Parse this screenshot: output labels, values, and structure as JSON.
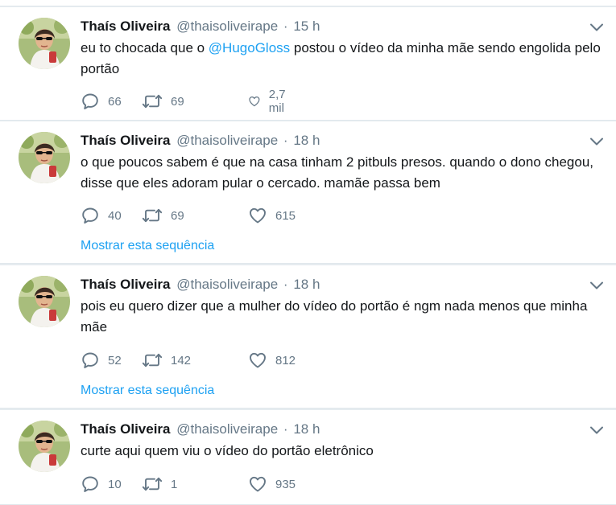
{
  "tweets": [
    {
      "name": "Thaís Oliveira",
      "handle": "@thaisoliveirape",
      "separator": "·",
      "time": "15 h",
      "text_before": "eu to chocada que o ",
      "mention": "@HugoGloss",
      "text_after": " postou o vídeo da minha mãe sendo engolida pelo portão",
      "replies": "66",
      "retweets": "69",
      "likes": "2,7 mil"
    },
    {
      "name": "Thaís Oliveira",
      "handle": "@thaisoliveirape",
      "separator": "·",
      "time": "18 h",
      "text": "o que poucos sabem é que na casa tinham 2 pitbuls presos. quando o dono chegou, disse que eles adoram pular o cercado. mamãe passa bem",
      "replies": "40",
      "retweets": "69",
      "likes": "615",
      "show_thread": "Mostrar esta sequência"
    },
    {
      "name": "Thaís Oliveira",
      "handle": "@thaisoliveirape",
      "separator": "·",
      "time": "18 h",
      "text": "pois eu quero dizer que a mulher do vídeo do portão é ngm nada menos que minha mãe",
      "replies": "52",
      "retweets": "142",
      "likes": "812",
      "show_thread": "Mostrar esta sequência"
    },
    {
      "name": "Thaís Oliveira",
      "handle": "@thaisoliveirape",
      "separator": "·",
      "time": "18 h",
      "text": "curte aqui quem viu o vídeo do portão eletrônico",
      "replies": "10",
      "retweets": "1",
      "likes": "935"
    }
  ],
  "icons": {
    "reply": "reply-icon",
    "retweet": "retweet-icon",
    "like": "heart-icon",
    "menu": "chevron-down-icon"
  },
  "colors": {
    "link": "#1da1f2",
    "secondary_text": "#657786",
    "background": "#e6ecf0"
  }
}
